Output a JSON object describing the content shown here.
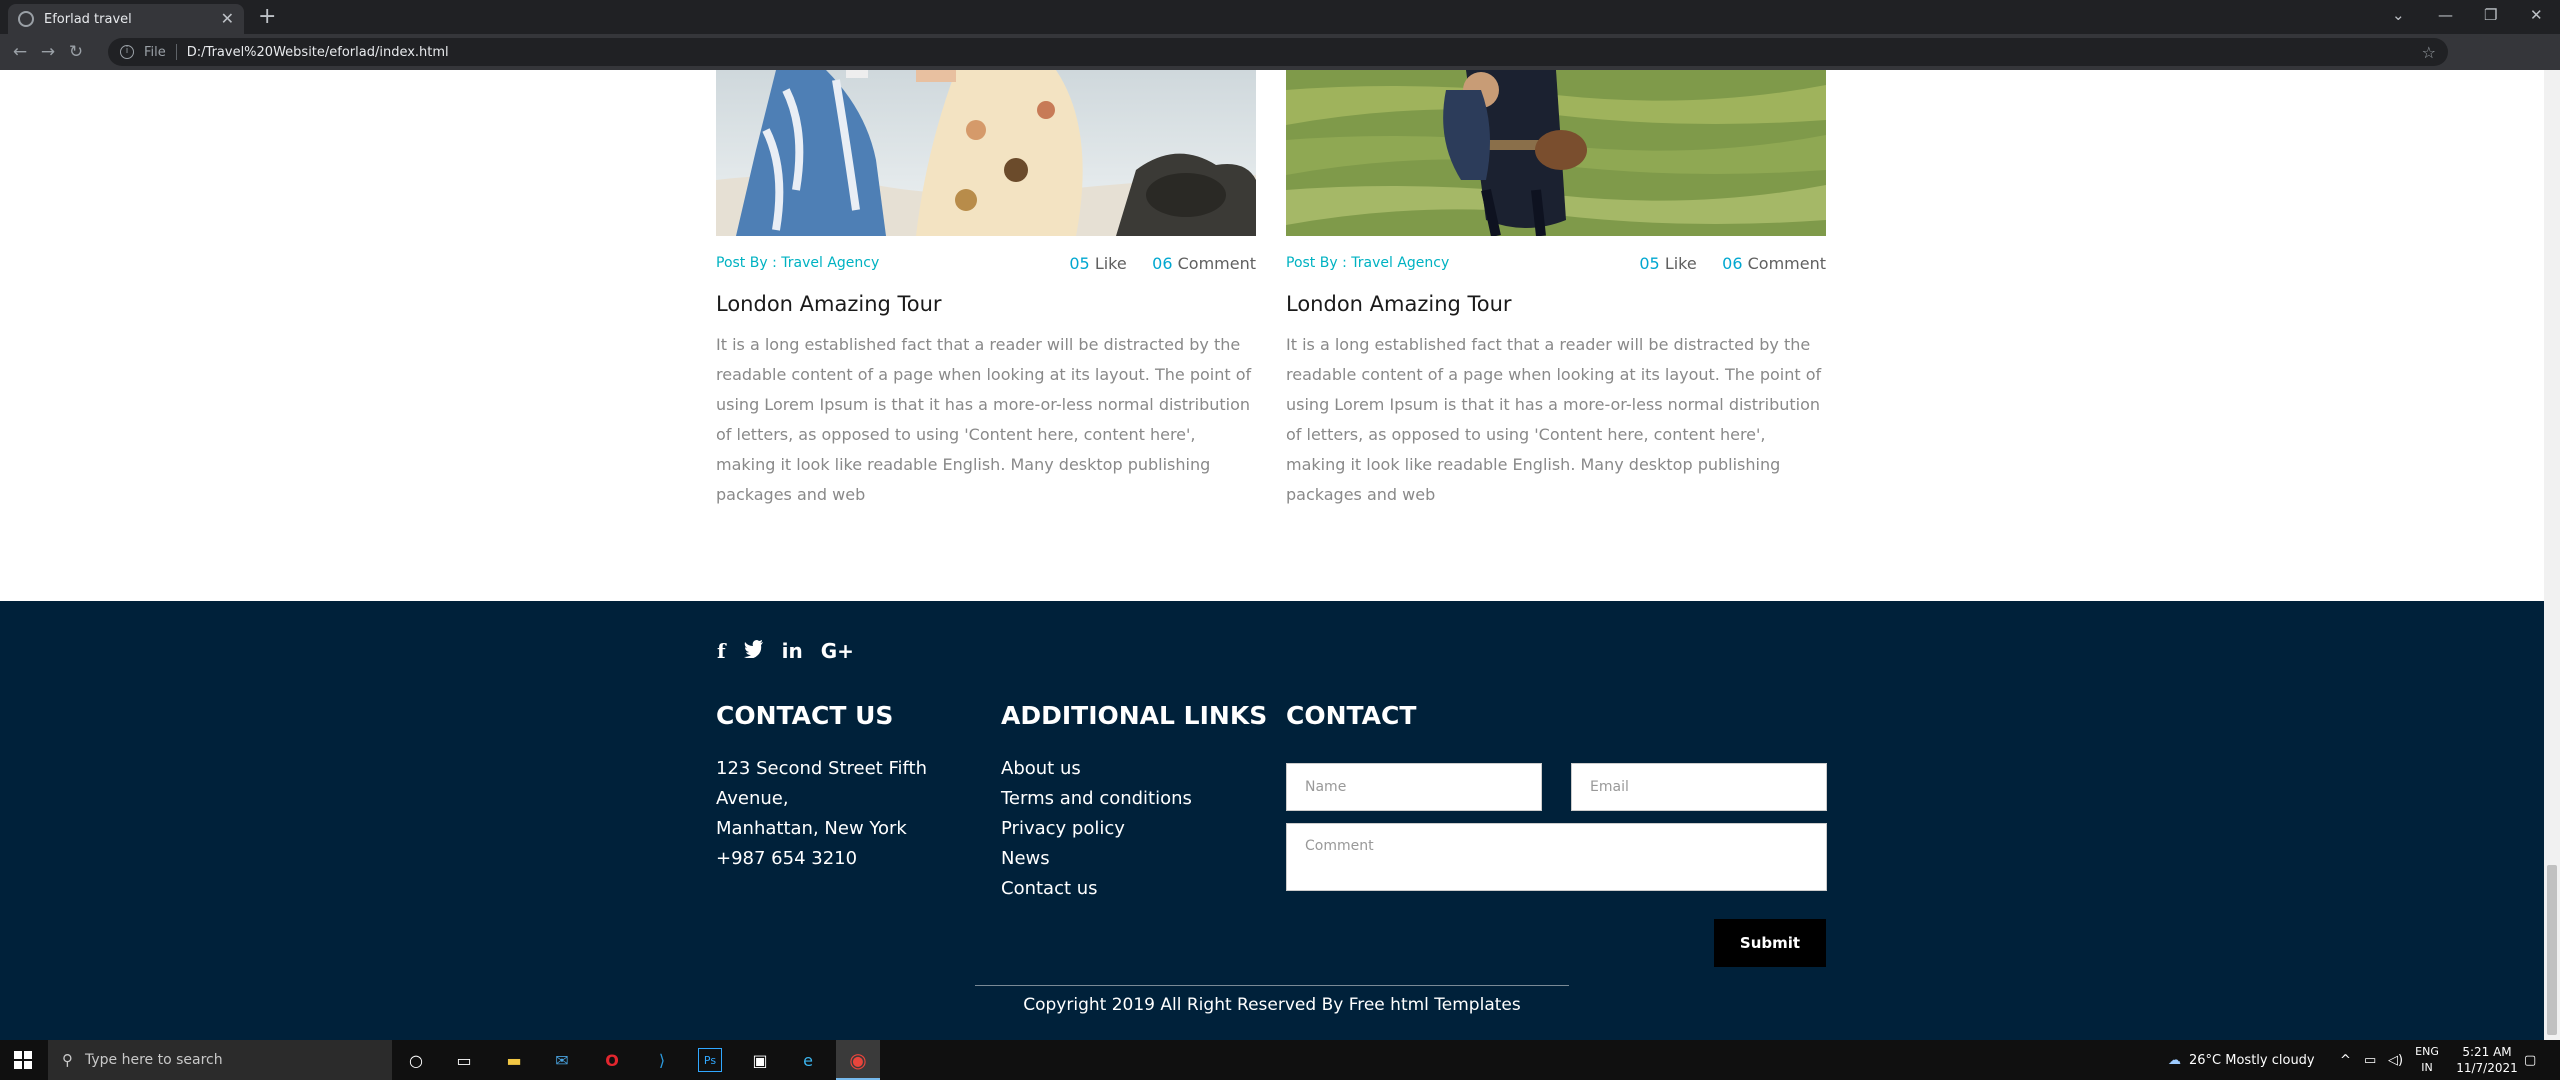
{
  "browser": {
    "tab_title": "Eforlad travel",
    "url_scheme": "File",
    "url": "D:/Travel%20Website/eforlad/index.html"
  },
  "cards": [
    {
      "post_by": "Post By : Travel Agency",
      "likes_num": "05",
      "likes_label": "Like",
      "comments_num": "06",
      "comments_label": "Comment",
      "title": "London Amazing Tour",
      "text": "It is a long established fact that a reader will be distracted by the readable content of a page when looking at its layout. The point of using Lorem Ipsum is that it has a more-or-less normal distribution of letters, as opposed to using 'Content here, content here', making it look like readable English. Many desktop publishing packages and web"
    },
    {
      "post_by": "Post By : Travel Agency",
      "likes_num": "05",
      "likes_label": "Like",
      "comments_num": "06",
      "comments_label": "Comment",
      "title": "London Amazing Tour",
      "text": "It is a long established fact that a reader will be distracted by the readable content of a page when looking at its layout. The point of using Lorem Ipsum is that it has a more-or-less normal distribution of letters, as opposed to using 'Content here, content here', making it look like readable English. Many desktop publishing packages and web"
    }
  ],
  "footer": {
    "social_icons": [
      "facebook-icon",
      "twitter-icon",
      "linkedin-icon",
      "google-plus-icon"
    ],
    "contact_us": {
      "heading": "CONTACT US",
      "address_line1": "123 Second Street Fifth",
      "address_line2": "Avenue,",
      "address_line3": "Manhattan, New York",
      "phone": "+987 654 3210"
    },
    "additional_links": {
      "heading": "ADDITIONAL LINKS",
      "links": [
        "About us",
        "Terms and conditions",
        "Privacy policy",
        "News",
        "Contact us"
      ]
    },
    "contact_form": {
      "heading": "CONTACT",
      "name_placeholder": "Name",
      "email_placeholder": "Email",
      "comment_placeholder": "Comment",
      "submit_label": "Submit"
    },
    "copyright": "Copyright 2019 All Right Reserved By Free html Templates"
  },
  "taskbar": {
    "search_placeholder": "Type here to search",
    "weather": "26°C  Mostly cloudy",
    "lang_line1": "ENG",
    "lang_line2": "IN",
    "time": "5:21 AM",
    "date": "11/7/2021"
  },
  "colors": {
    "footer_bg": "#00213a",
    "accent": "#00b2c2",
    "link_num": "#00a7d0"
  }
}
